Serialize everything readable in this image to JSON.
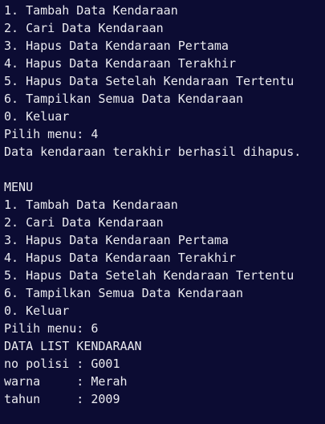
{
  "terminal": {
    "lines": [
      "1. Tambah Data Kendaraan",
      "2. Cari Data Kendaraan",
      "3. Hapus Data Kendaraan Pertama",
      "4. Hapus Data Kendaraan Terakhir",
      "5. Hapus Data Setelah Kendaraan Tertentu",
      "6. Tampilkan Semua Data Kendaraan",
      "0. Keluar",
      "Pilih menu: 4",
      "Data kendaraan terakhir berhasil dihapus.",
      "",
      "MENU",
      "1. Tambah Data Kendaraan",
      "2. Cari Data Kendaraan",
      "3. Hapus Data Kendaraan Pertama",
      "4. Hapus Data Kendaraan Terakhir",
      "5. Hapus Data Setelah Kendaraan Tertentu",
      "6. Tampilkan Semua Data Kendaraan",
      "0. Keluar",
      "Pilih menu: 6",
      "DATA LIST KENDARAAN",
      "no polisi : G001",
      "warna     : Merah",
      "tahun     : 2009"
    ]
  }
}
